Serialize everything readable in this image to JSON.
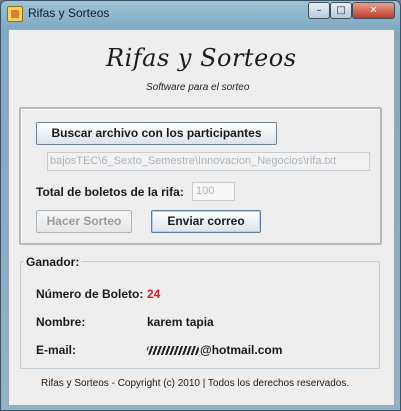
{
  "window": {
    "title": "Rifas y Sorteos",
    "buttons": {
      "minimize": "–",
      "maximize": "□",
      "close": "✕"
    }
  },
  "header": {
    "title": "Rifas y Sorteos",
    "subtitle": "Software para el sorteo"
  },
  "file_panel": {
    "browse_button": "Buscar archivo con los participantes",
    "file_path": "bajosTEC\\6_Sexto_Semestre\\Innovacion_Negocios\\rifa.txt",
    "total_label": "Total de boletos de la rifa:",
    "total_value": "100",
    "draw_button": "Hacer Sorteo",
    "email_button": "Enviar correo"
  },
  "winner_panel": {
    "legend": "Ganador:",
    "ticket_label": "Número de Boleto:",
    "ticket_value": "24",
    "name_label": "Nombre:",
    "name_value": "karem tapia",
    "email_label": "E-mail:",
    "email_value": "@hotmail.com"
  },
  "footer": "Rifas y Sorteos - Copyright (c) 2010 | Todos los derechos reservados.",
  "colors": {
    "ticket_number": "#d61f1f",
    "disabled_text": "#9a9a9a"
  },
  "icons": {
    "app": "ticket-icon"
  }
}
